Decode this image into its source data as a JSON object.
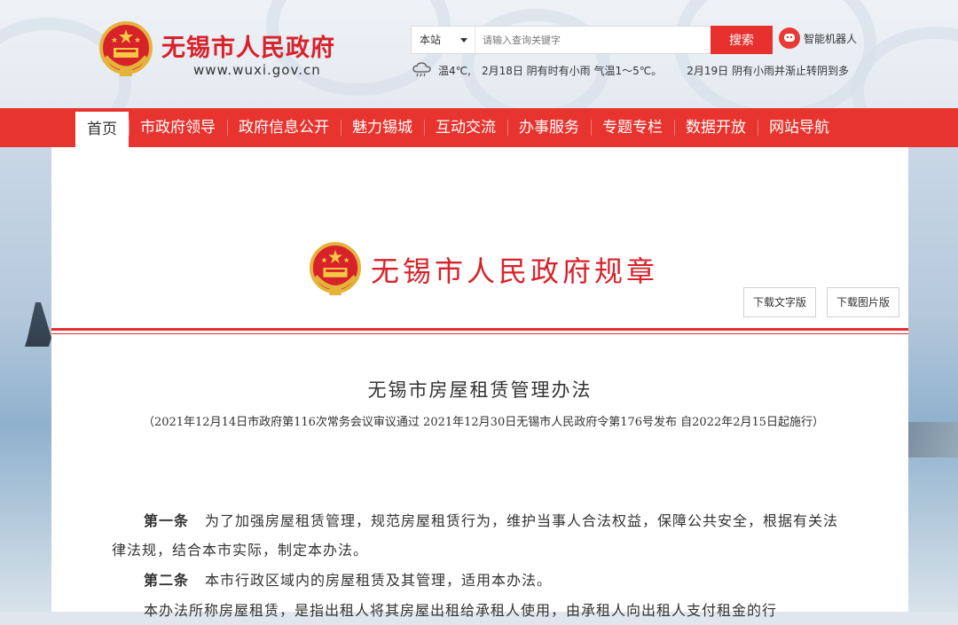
{
  "header": {
    "site_title": "无锡市人民政府",
    "site_url": "www.wuxi.gov.cn",
    "search": {
      "scope": "本站",
      "placeholder": "请输入查询关键字",
      "button": "搜索"
    },
    "robot_label": "智能机器人",
    "weather": {
      "temp": "温4℃,",
      "today": "2月18日 阴有时有小雨 气温1～5℃。",
      "tomorrow": "2月19日 阴有小雨并渐止转阴到多"
    }
  },
  "nav": {
    "items": [
      "首页",
      "市政府领导",
      "政府信息公开",
      "魅力锡城",
      "互动交流",
      "办事服务",
      "专题专栏",
      "数据开放",
      "网站导航"
    ],
    "active": "首页"
  },
  "document": {
    "banner_title": "无锡市人民政府规章",
    "download_text": "下载文字版",
    "download_image": "下载图片版",
    "title": "无锡市房屋租赁管理办法",
    "note": "（2021年12月14日市政府第116次常务会议审议通过 2021年12月30日无锡市人民政府令第176号发布 自2022年2月15日起施行）",
    "articles": [
      {
        "no": "第一条",
        "text": "为了加强房屋租赁管理，规范房屋租赁行为，维护当事人合法权益，保障公共安全，根据有关法律法规，结合本市实际，制定本办法。"
      },
      {
        "no": "第二条",
        "text": "本市行政区域内的房屋租赁及其管理，适用本办法。"
      }
    ],
    "para3": "本办法所称房屋租赁，是指出租人将其房屋出租给承租人使用，由承租人向出租人支付租金的行"
  },
  "colors": {
    "brand_red": "#e8342f",
    "title_red": "#d8222a"
  }
}
